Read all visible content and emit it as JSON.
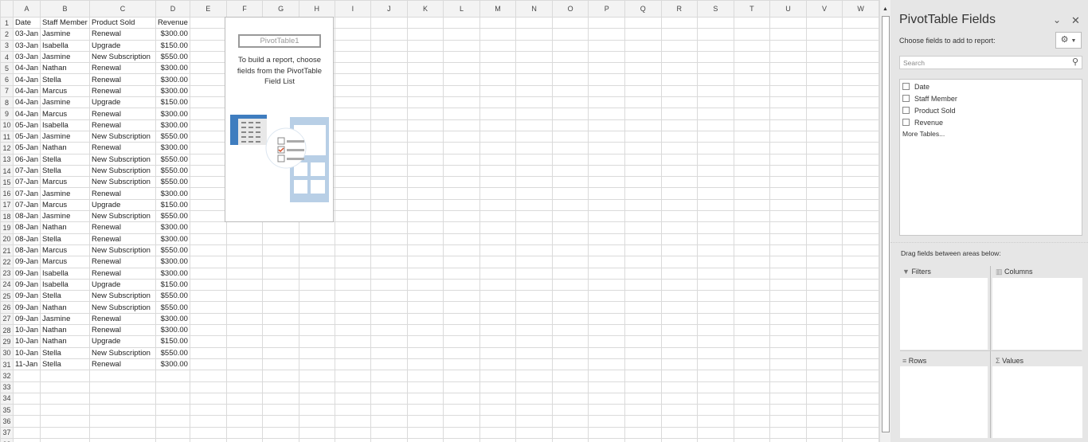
{
  "columns": [
    "A",
    "B",
    "C",
    "D",
    "E",
    "F",
    "G",
    "H",
    "I",
    "J",
    "K",
    "L",
    "M",
    "N",
    "O",
    "P",
    "Q",
    "R",
    "S",
    "T",
    "U",
    "V",
    "W"
  ],
  "header_row": [
    "Date",
    "Staff Member",
    "Product Sold",
    "Revenue"
  ],
  "rows": [
    [
      "03-Jan",
      "Jasmine",
      "Renewal",
      "$300.00"
    ],
    [
      "03-Jan",
      "Isabella",
      "Upgrade",
      "$150.00"
    ],
    [
      "03-Jan",
      "Jasmine",
      "New Subscription",
      "$550.00"
    ],
    [
      "04-Jan",
      "Nathan",
      "Renewal",
      "$300.00"
    ],
    [
      "04-Jan",
      "Stella",
      "Renewal",
      "$300.00"
    ],
    [
      "04-Jan",
      "Marcus",
      "Renewal",
      "$300.00"
    ],
    [
      "04-Jan",
      "Jasmine",
      "Upgrade",
      "$150.00"
    ],
    [
      "04-Jan",
      "Marcus",
      "Renewal",
      "$300.00"
    ],
    [
      "05-Jan",
      "Isabella",
      "Renewal",
      "$300.00"
    ],
    [
      "05-Jan",
      "Jasmine",
      "New Subscription",
      "$550.00"
    ],
    [
      "05-Jan",
      "Nathan",
      "Renewal",
      "$300.00"
    ],
    [
      "06-Jan",
      "Stella",
      "New Subscription",
      "$550.00"
    ],
    [
      "07-Jan",
      "Stella",
      "New Subscription",
      "$550.00"
    ],
    [
      "07-Jan",
      "Marcus",
      "New Subscription",
      "$550.00"
    ],
    [
      "07-Jan",
      "Jasmine",
      "Renewal",
      "$300.00"
    ],
    [
      "07-Jan",
      "Marcus",
      "Upgrade",
      "$150.00"
    ],
    [
      "08-Jan",
      "Jasmine",
      "New Subscription",
      "$550.00"
    ],
    [
      "08-Jan",
      "Nathan",
      "Renewal",
      "$300.00"
    ],
    [
      "08-Jan",
      "Stella",
      "Renewal",
      "$300.00"
    ],
    [
      "08-Jan",
      "Marcus",
      "New Subscription",
      "$550.00"
    ],
    [
      "09-Jan",
      "Marcus",
      "Renewal",
      "$300.00"
    ],
    [
      "09-Jan",
      "Isabella",
      "Renewal",
      "$300.00"
    ],
    [
      "09-Jan",
      "Isabella",
      "Upgrade",
      "$150.00"
    ],
    [
      "09-Jan",
      "Stella",
      "New Subscription",
      "$550.00"
    ],
    [
      "09-Jan",
      "Nathan",
      "New Subscription",
      "$550.00"
    ],
    [
      "09-Jan",
      "Jasmine",
      "Renewal",
      "$300.00"
    ],
    [
      "10-Jan",
      "Nathan",
      "Renewal",
      "$300.00"
    ],
    [
      "10-Jan",
      "Nathan",
      "Upgrade",
      "$150.00"
    ],
    [
      "10-Jan",
      "Stella",
      "New Subscription",
      "$550.00"
    ],
    [
      "11-Jan",
      "Stella",
      "Renewal",
      "$300.00"
    ]
  ],
  "pivot_placeholder": {
    "name": "PivotTable1",
    "message": "To build a report, choose fields from the PivotTable Field List"
  },
  "panel": {
    "title": "PivotTable Fields",
    "subtitle": "Choose fields to add to report:",
    "search_placeholder": "Search",
    "fields": [
      "Date",
      "Staff Member",
      "Product Sold",
      "Revenue"
    ],
    "more_tables": "More Tables...",
    "drag_hint": "Drag fields between areas below:",
    "areas": {
      "filters": "Filters",
      "columns": "Columns",
      "rows": "Rows",
      "values": "Values"
    },
    "icons": {
      "collapse": "chevron-down-icon",
      "close": "close-icon",
      "settings": "gear-icon",
      "search": "search-icon"
    }
  }
}
